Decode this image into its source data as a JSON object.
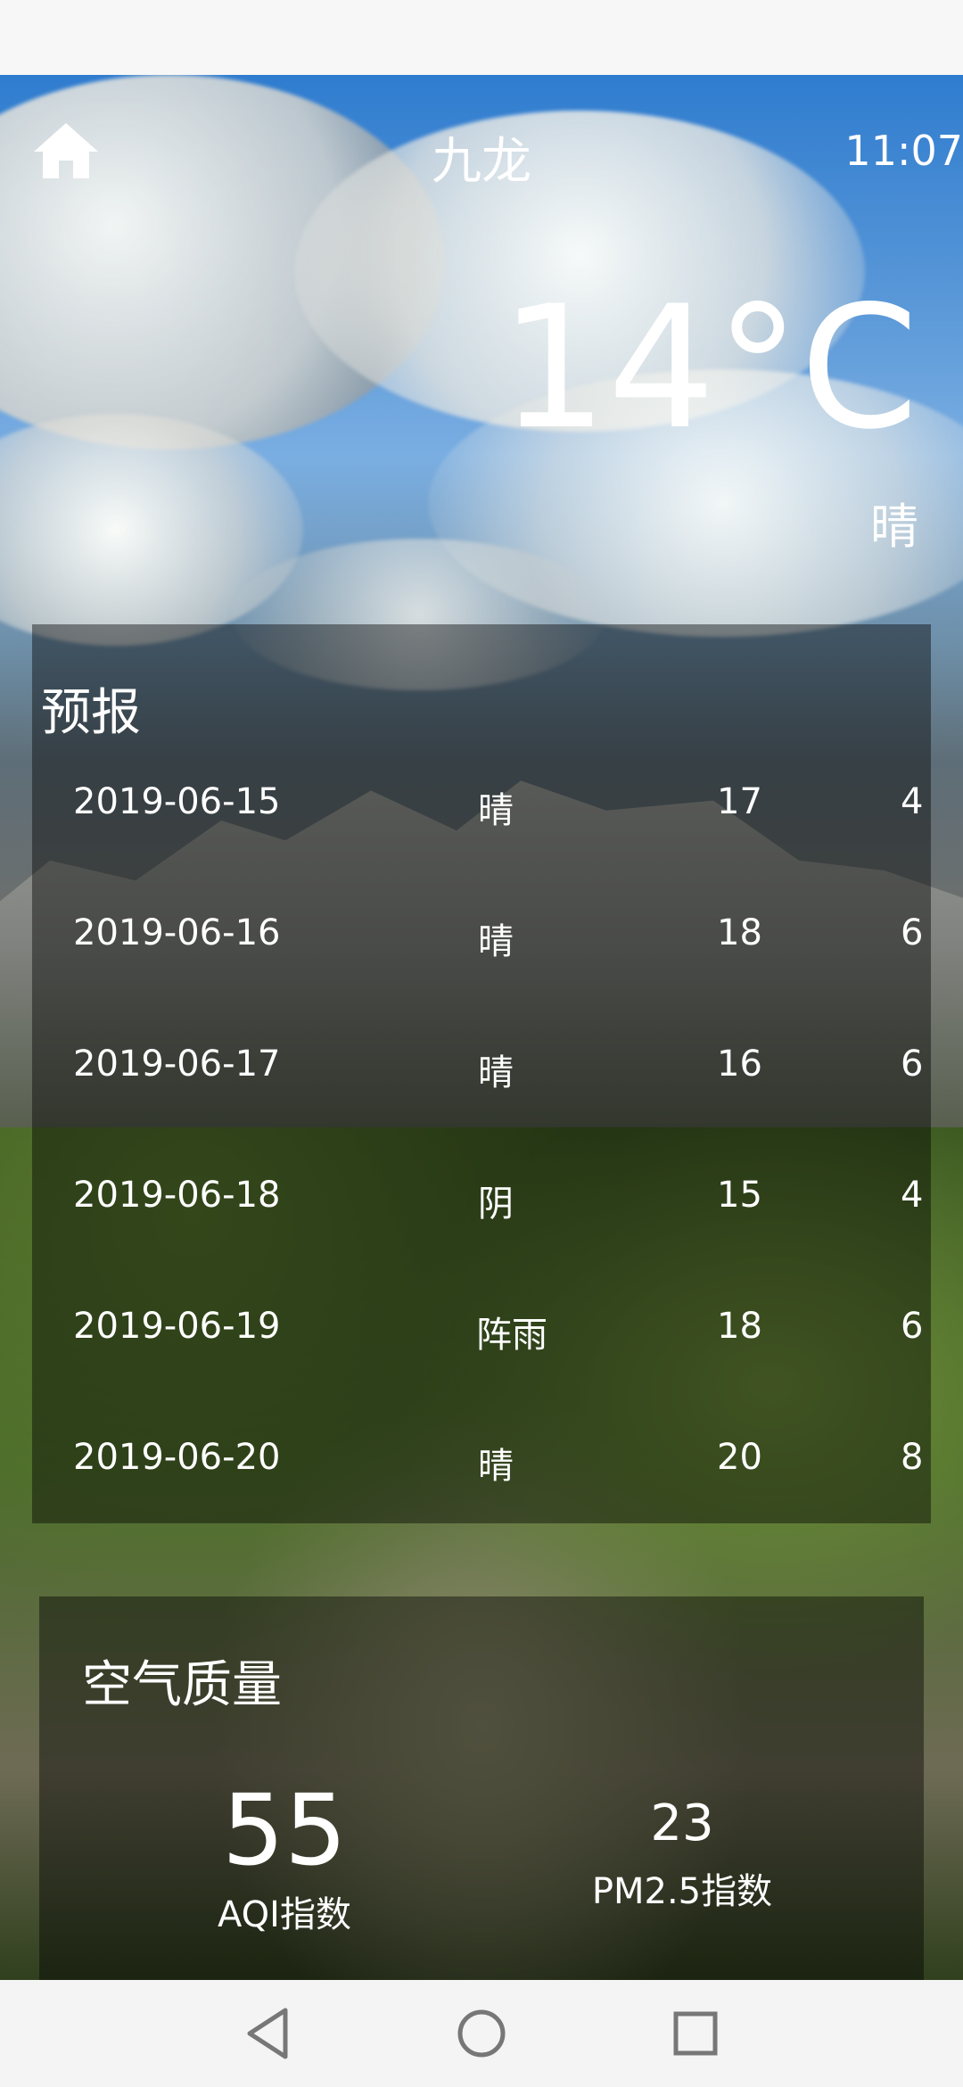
{
  "header": {
    "home_icon": "home-icon",
    "city": "九龙",
    "time": "11:07"
  },
  "current": {
    "temperature": "14°C",
    "condition": "晴"
  },
  "forecast": {
    "title": "预报",
    "rows": [
      {
        "date": "2019-06-15",
        "condition": "晴",
        "max": "17",
        "min": "4"
      },
      {
        "date": "2019-06-16",
        "condition": "晴",
        "max": "18",
        "min": "6"
      },
      {
        "date": "2019-06-17",
        "condition": "晴",
        "max": "16",
        "min": "6"
      },
      {
        "date": "2019-06-18",
        "condition": "阴",
        "max": "15",
        "min": "4"
      },
      {
        "date": "2019-06-19",
        "condition": "阵雨",
        "max": "18",
        "min": "6"
      },
      {
        "date": "2019-06-20",
        "condition": "晴",
        "max": "20",
        "min": "8"
      }
    ]
  },
  "air_quality": {
    "title": "空气质量",
    "aqi_value": "55",
    "aqi_label": "AQI指数",
    "pm25_value": "23",
    "pm25_label": "PM2.5指数"
  },
  "nav": {
    "back_icon": "back-icon",
    "home_icon": "home-circle-icon",
    "recents_icon": "recents-icon"
  }
}
